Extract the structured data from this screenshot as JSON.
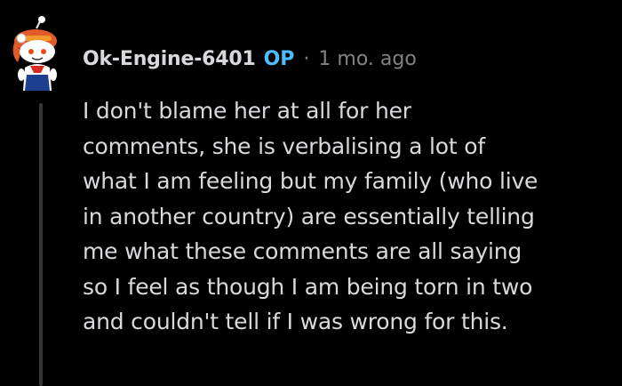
{
  "comment": {
    "username": "Ok-Engine-6401",
    "op_badge": "OP",
    "separator": "·",
    "timestamp": "1 mo. ago",
    "avatar_icon": "snoo-avatar-icon",
    "body_lines": [
      "I don't blame her at all for her",
      "comments, she is verbalising a lot of",
      "what I am feeling but my family (who live",
      "in another country) are essentially telling",
      "me what these comments are all saying",
      "so I feel as though I am being torn in two",
      "and couldn't tell if I was wrong for this."
    ]
  },
  "colors": {
    "background": "#000000",
    "text": "#d7dadc",
    "op_accent": "#4fbcff",
    "muted": "#818384",
    "thread_line": "#343536"
  }
}
